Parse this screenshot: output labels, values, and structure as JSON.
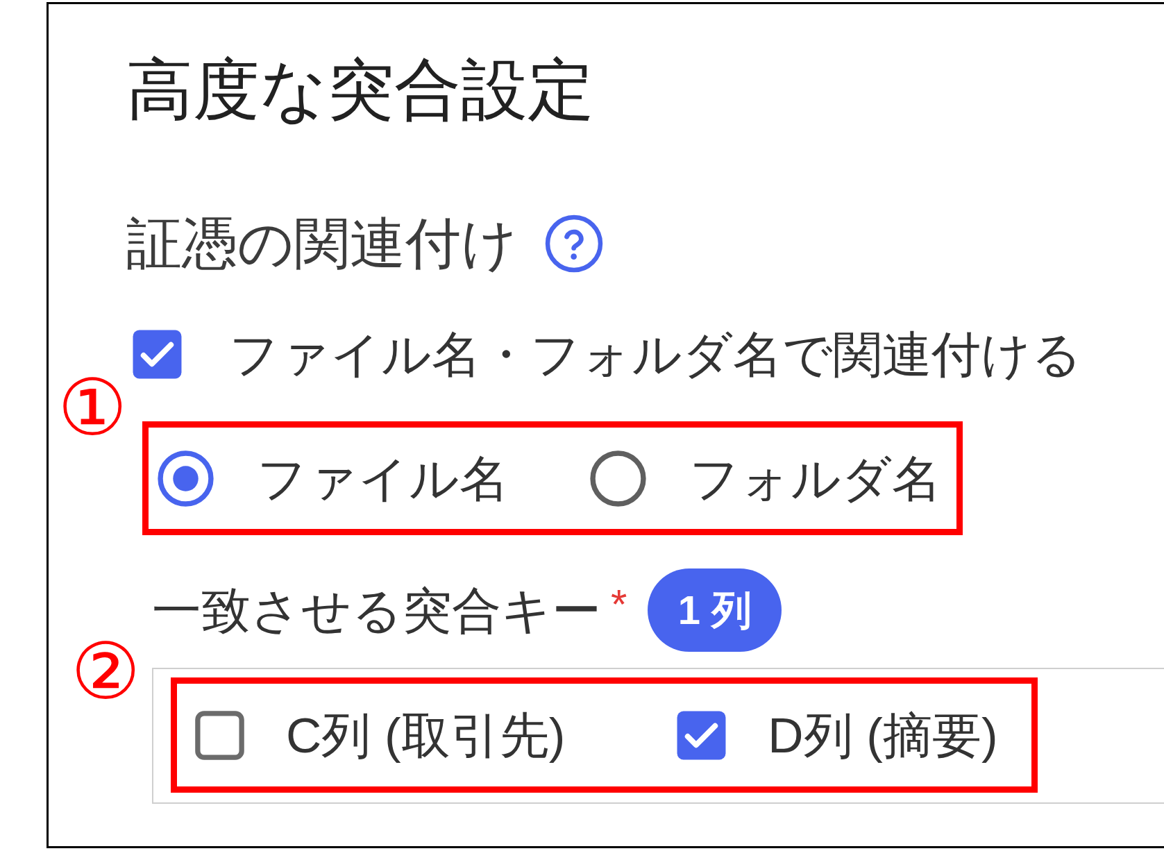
{
  "panel": {
    "title": "高度な突合設定"
  },
  "evidence_link": {
    "heading": "証憑の関連付け",
    "link_by_name": {
      "label": "ファイル名・フォルダ名で関連付ける",
      "checked": true
    },
    "name_source": {
      "annotation": "①",
      "options": [
        {
          "label": "ファイル名",
          "selected": true
        },
        {
          "label": "フォルダ名",
          "selected": false
        }
      ]
    }
  },
  "match_keys": {
    "label": "一致させる突合キー",
    "required_mark": "*",
    "count_badge": "1 列",
    "annotation": "②",
    "options": [
      {
        "label": "C列 (取引先)",
        "checked": false
      },
      {
        "label": "D列 (摘要)",
        "checked": true
      }
    ]
  }
}
